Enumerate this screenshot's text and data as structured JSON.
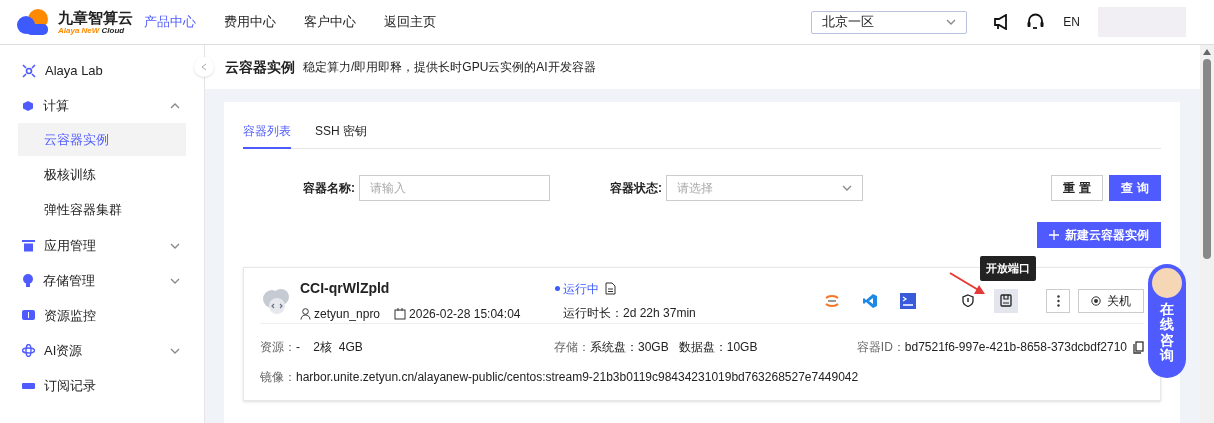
{
  "header": {
    "logo": {
      "name": "九章智算云",
      "tagline_accent": "Alaya NeW",
      "tagline": "Cloud"
    },
    "nav": [
      {
        "label": "产品中心",
        "selected": true
      },
      {
        "label": "费用中心",
        "selected": false
      },
      {
        "label": "客户中心",
        "selected": false
      },
      {
        "label": "返回主页",
        "selected": false
      }
    ],
    "region": {
      "value": "北京一区"
    },
    "language": "EN"
  },
  "sidebar": {
    "items": [
      {
        "label": "Alaya Lab",
        "kind": "lab"
      },
      {
        "label": "计算",
        "kind": "cube",
        "expanded": true,
        "children": [
          {
            "label": "云容器实例",
            "selected": true
          },
          {
            "label": "极核训练",
            "selected": false
          },
          {
            "label": "弹性容器集群",
            "selected": false
          }
        ]
      },
      {
        "label": "应用管理",
        "kind": "app",
        "expanded": false
      },
      {
        "label": "存储管理",
        "kind": "storage",
        "expanded": false
      },
      {
        "label": "资源监控",
        "kind": "monitor"
      },
      {
        "label": "AI资源",
        "kind": "ai",
        "expanded": false
      },
      {
        "label": "订阅记录",
        "kind": "record"
      }
    ]
  },
  "page": {
    "title": "云容器实例",
    "subtitle": "稳定算力/即用即释，提供长时GPU云实例的AI开发容器"
  },
  "tabs": [
    {
      "label": "容器列表",
      "selected": true
    },
    {
      "label": "SSH 密钥",
      "selected": false
    }
  ],
  "filters": [
    {
      "label": "容器名称:",
      "placeholder": "请输入",
      "kind": "input"
    },
    {
      "label": "容器状态:",
      "placeholder": "请选择",
      "kind": "select"
    }
  ],
  "filter_buttons": {
    "reset": "重 置",
    "search": "查 询"
  },
  "create_button": "新建云容器实例",
  "instance": {
    "name": "CCI-qrWlZpld",
    "user": "zetyun_npro",
    "created": "2026-02-28 15:04:04",
    "status": {
      "label": "运行中",
      "kind": "running"
    },
    "runtime_label": "运行时长：",
    "runtime": "2d 22h 37min",
    "tools": [
      {
        "kind": "jupyter",
        "highlighted": false
      },
      {
        "kind": "vscode",
        "highlighted": false
      },
      {
        "kind": "ssh",
        "highlighted": false
      },
      {
        "kind": "shield",
        "highlighted": false
      },
      {
        "kind": "port",
        "highlighted": true,
        "tooltip": "开放端口"
      }
    ],
    "shutdown_button": "关机",
    "resource_label": "资源：",
    "resource_gpu": "-",
    "resource_cpu": "2核",
    "resource_mem": "4GB",
    "storage_label": "存储：",
    "system_disk_label": "系统盘：",
    "system_disk": "30GB",
    "data_disk_label": "数据盘：",
    "data_disk": "10GB",
    "id_label": "容器ID：",
    "id": "bd7521f6-997e-421b-8658-373dcbdf2710",
    "image_label": "镜像：",
    "image": "harbor.unite.zetyun.cn/alayanew-public/centos:stream9-21b3b0119c98434231019bd763268527e7449042"
  },
  "chat_widget": {
    "label": "在线咨询"
  }
}
